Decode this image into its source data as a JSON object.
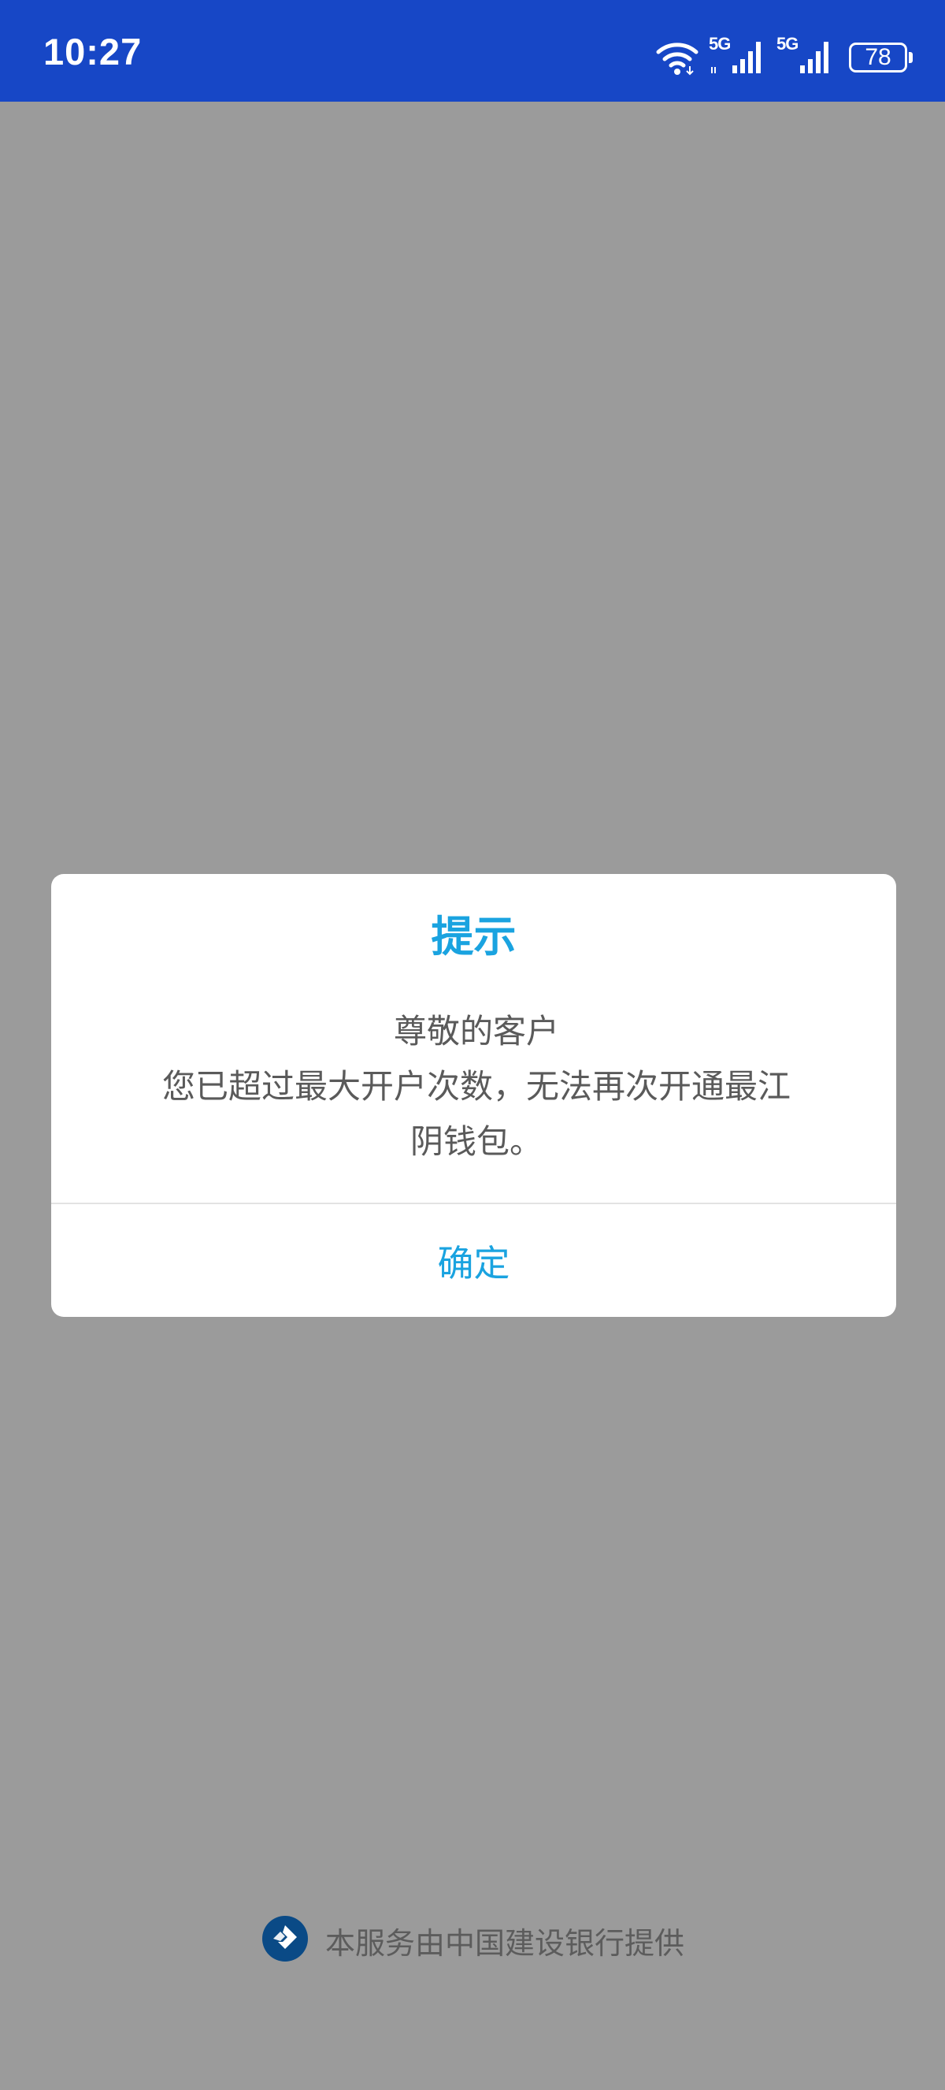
{
  "status_bar": {
    "time": "10:27",
    "network_1": "5G",
    "network_2": "5G",
    "battery": "78",
    "icons": [
      "wifi-icon",
      "signal-icon",
      "signal-icon",
      "battery-icon"
    ]
  },
  "dialog": {
    "title": "提示",
    "message_lines": [
      "尊敬的客户",
      "您已超过最大开户次数，无法再次开通最江",
      "阴钱包。"
    ],
    "confirm_label": "确定"
  },
  "footer": {
    "text": "本服务由中国建设银行提供",
    "logo_icon": "ccb-logo-icon"
  },
  "colors": {
    "status_bar": "#1747c6",
    "overlay": "#9b9b9b",
    "accent": "#1aa3e0",
    "ccb_blue": "#0a4a86"
  }
}
